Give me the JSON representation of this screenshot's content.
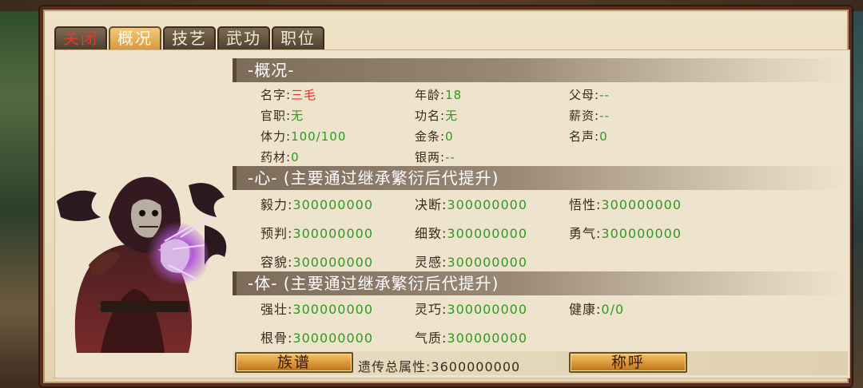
{
  "tabs": [
    {
      "label": "关闭",
      "active": false
    },
    {
      "label": "概况",
      "active": true
    },
    {
      "label": "技艺",
      "active": false
    },
    {
      "label": "武功",
      "active": false
    },
    {
      "label": "职位",
      "active": false
    }
  ],
  "overview": {
    "header": "-概况-",
    "fields": [
      {
        "label": "名字:",
        "value": "三毛"
      },
      {
        "label": "年龄:",
        "value": "18"
      },
      {
        "label": "父母:",
        "value": "--"
      },
      {
        "label": "官职:",
        "value": "无"
      },
      {
        "label": "功名:",
        "value": "无"
      },
      {
        "label": "薪资:",
        "value": "--"
      },
      {
        "label": "体力:",
        "value": "100/100"
      },
      {
        "label": "金条:",
        "value": "0"
      },
      {
        "label": "名声:",
        "value": "0"
      },
      {
        "label": "药材:",
        "value": "0"
      },
      {
        "label": "银两:",
        "value": "--"
      }
    ]
  },
  "heart": {
    "header": "-心-  (主要通过继承繁衍后代提升)",
    "fields": [
      {
        "label": "毅力:",
        "value": "300000000"
      },
      {
        "label": "决断:",
        "value": "300000000"
      },
      {
        "label": "悟性:",
        "value": "300000000"
      },
      {
        "label": "预判:",
        "value": "300000000"
      },
      {
        "label": "细致:",
        "value": "300000000"
      },
      {
        "label": "勇气:",
        "value": "300000000"
      },
      {
        "label": "容貌:",
        "value": "300000000"
      },
      {
        "label": "灵感:",
        "value": "300000000"
      }
    ]
  },
  "body_stats": {
    "header": "-体-  (主要通过继承繁衍后代提升)",
    "fields": [
      {
        "label": "强壮:",
        "value": "300000000"
      },
      {
        "label": "灵巧:",
        "value": "300000000"
      },
      {
        "label": "健康:",
        "value": "0/0"
      },
      {
        "label": "根骨:",
        "value": "300000000"
      },
      {
        "label": "气质:",
        "value": "300000000"
      }
    ]
  },
  "bottom": {
    "genealogy_button": "族谱",
    "total_label": "遗传总属性:",
    "total_value": "3600000000",
    "title_button": "称呼"
  },
  "colors": {
    "value_green": "#2f9a1f",
    "value_red": "#e23226",
    "tab_active": "#e0a54c",
    "header_bg": "#8a7866"
  }
}
